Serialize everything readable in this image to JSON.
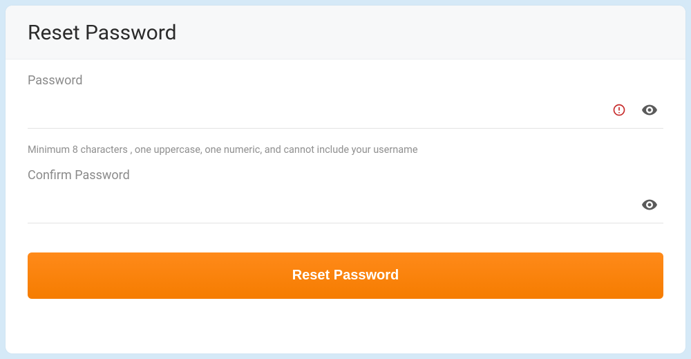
{
  "header": {
    "title": "Reset Password"
  },
  "form": {
    "password": {
      "label": "Password",
      "value": "",
      "hint": "Minimum 8 characters , one uppercase, one numeric, and cannot include your username"
    },
    "confirm_password": {
      "label": "Confirm Password",
      "value": ""
    },
    "submit_label": "Reset Password"
  },
  "colors": {
    "accent": "#f57c00",
    "error": "#c62828"
  }
}
